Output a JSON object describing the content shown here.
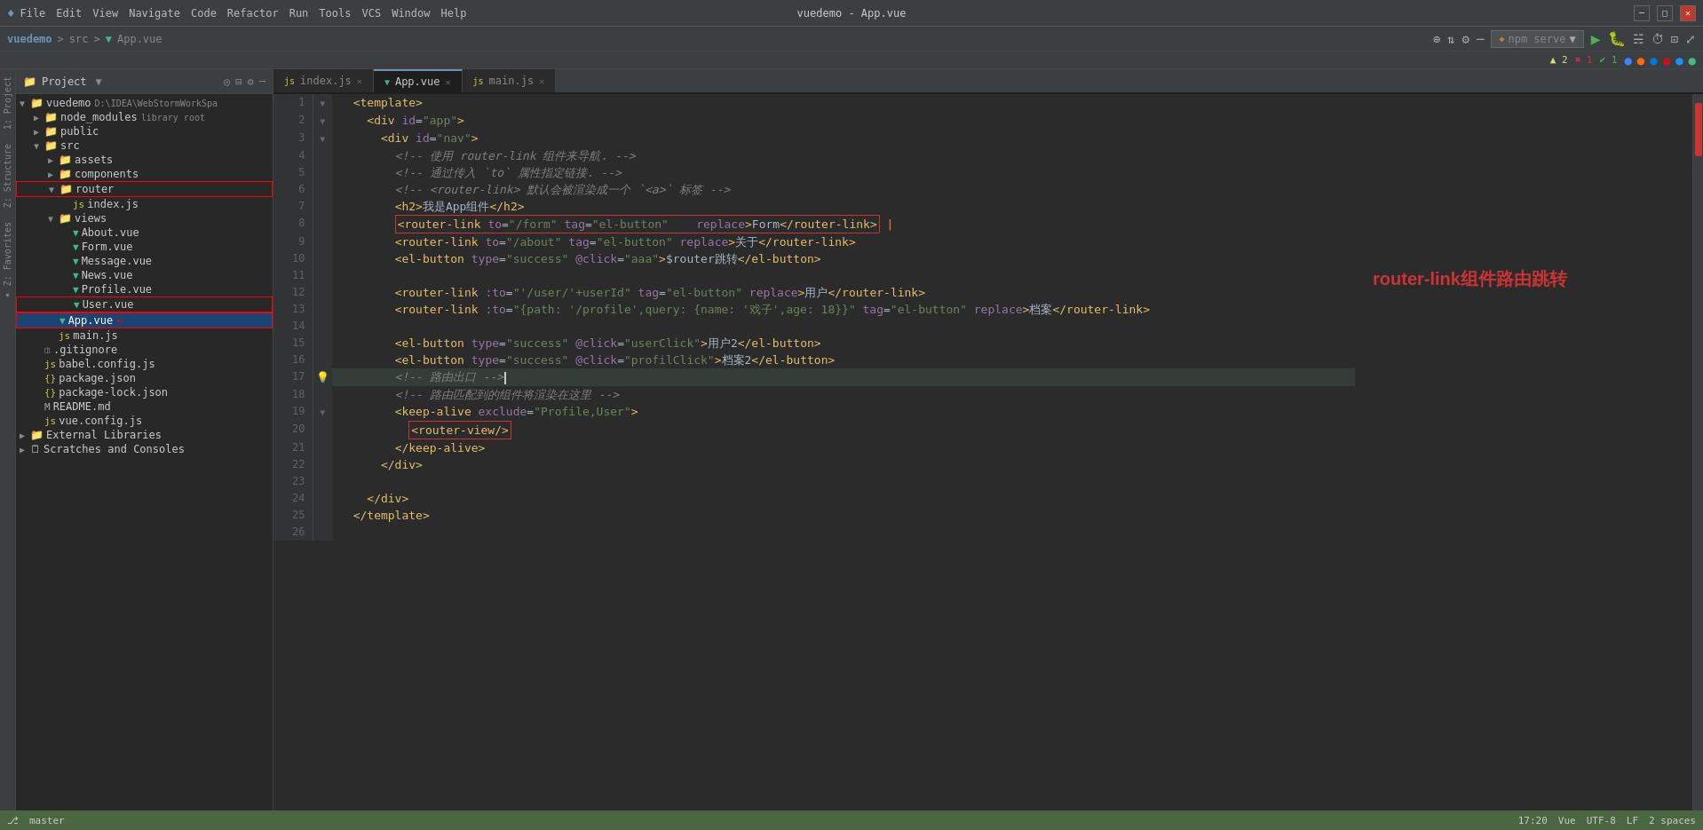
{
  "titleBar": {
    "appIcon": "♦",
    "menus": [
      "File",
      "Edit",
      "View",
      "Navigate",
      "Code",
      "Refactor",
      "Run",
      "Tools",
      "VCS",
      "Window",
      "Help"
    ],
    "title": "vuedemo - App.vue",
    "winMin": "─",
    "winMax": "□",
    "winClose": "✕"
  },
  "breadcrumb": {
    "project": "vuedemo",
    "sep1": ">",
    "src": "src",
    "sep2": ">",
    "file": "App.vue"
  },
  "tabs": [
    {
      "label": "index.js",
      "type": "js",
      "active": false,
      "closable": true
    },
    {
      "label": "App.vue",
      "type": "vue",
      "active": true,
      "closable": true
    },
    {
      "label": "main.js",
      "type": "js",
      "active": false,
      "closable": true
    }
  ],
  "fileTree": {
    "title": "Project",
    "items": [
      {
        "id": "vuedemo",
        "label": "vuedemo",
        "path": "D:\\IDEA\\WebStormWorkSpa",
        "indent": 0,
        "type": "folder",
        "expanded": true
      },
      {
        "id": "node_modules",
        "label": "node_modules",
        "badge": "library root",
        "indent": 1,
        "type": "folder",
        "expanded": false
      },
      {
        "id": "public",
        "label": "public",
        "indent": 1,
        "type": "folder",
        "expanded": false
      },
      {
        "id": "src",
        "label": "src",
        "indent": 1,
        "type": "folder",
        "expanded": true
      },
      {
        "id": "assets",
        "label": "assets",
        "indent": 2,
        "type": "folder",
        "expanded": false
      },
      {
        "id": "components",
        "label": "components",
        "indent": 2,
        "type": "folder",
        "expanded": false
      },
      {
        "id": "router",
        "label": "router",
        "indent": 2,
        "type": "folder",
        "expanded": true
      },
      {
        "id": "router_index",
        "label": "index.js",
        "indent": 3,
        "type": "js"
      },
      {
        "id": "views",
        "label": "views",
        "indent": 2,
        "type": "folder",
        "expanded": true
      },
      {
        "id": "about",
        "label": "About.vue",
        "indent": 3,
        "type": "vue"
      },
      {
        "id": "form",
        "label": "Form.vue",
        "indent": 3,
        "type": "vue"
      },
      {
        "id": "message",
        "label": "Message.vue",
        "indent": 3,
        "type": "vue"
      },
      {
        "id": "news",
        "label": "News.vue",
        "indent": 3,
        "type": "vue"
      },
      {
        "id": "profile",
        "label": "Profile.vue",
        "indent": 3,
        "type": "vue"
      },
      {
        "id": "user",
        "label": "User.vue",
        "indent": 3,
        "type": "vue",
        "redBorder": true
      },
      {
        "id": "appvue",
        "label": "App.vue",
        "indent": 2,
        "type": "vue",
        "selected": true,
        "redBorder": true
      },
      {
        "id": "mainjs",
        "label": "main.js",
        "indent": 2,
        "type": "js"
      },
      {
        "id": "gitignore",
        "label": ".gitignore",
        "indent": 1,
        "type": "git"
      },
      {
        "id": "babelconfig",
        "label": "babel.config.js",
        "indent": 1,
        "type": "js"
      },
      {
        "id": "packagejson",
        "label": "package.json",
        "indent": 1,
        "type": "json"
      },
      {
        "id": "packagelock",
        "label": "package-lock.json",
        "indent": 1,
        "type": "json"
      },
      {
        "id": "readme",
        "label": "README.md",
        "indent": 1,
        "type": "md"
      },
      {
        "id": "vueconfig",
        "label": "vue.config.js",
        "indent": 1,
        "type": "js"
      },
      {
        "id": "extlibs",
        "label": "External Libraries",
        "indent": 0,
        "type": "folder",
        "expanded": false
      },
      {
        "id": "scratches",
        "label": "Scratches and Consoles",
        "indent": 0,
        "type": "folder",
        "expanded": false
      }
    ]
  },
  "codeLines": [
    {
      "num": 1,
      "code": "  <template>",
      "type": "normal",
      "gutter": "fold"
    },
    {
      "num": 2,
      "code": "    <div id=\"app\">",
      "type": "normal",
      "gutter": "fold"
    },
    {
      "num": 3,
      "code": "      <div id=\"nav\">",
      "type": "normal",
      "gutter": "fold"
    },
    {
      "num": 4,
      "code": "        <!-- 使用 router-link 组件来导航. -->",
      "type": "comment"
    },
    {
      "num": 5,
      "code": "        <!-- 通过传入 `to` 属性指定链接. -->",
      "type": "comment"
    },
    {
      "num": 6,
      "code": "        <!-- <router-link> 默认会被渲染成一个 `<a>` 标签 -->",
      "type": "comment"
    },
    {
      "num": 7,
      "code": "        <h2>我是App组件</h2>",
      "type": "normal"
    },
    {
      "num": 8,
      "code": "        <router-link to=\"/form\" tag=\"el-button\"    replace>Form</router-link> |",
      "type": "normal",
      "redBox": true
    },
    {
      "num": 9,
      "code": "        <router-link to=\"/about\" tag=\"el-button\" replace>关于</router-link>",
      "type": "normal"
    },
    {
      "num": 10,
      "code": "        <el-button type=\"success\" @click=\"aaa\">$router跳转</el-button>",
      "type": "normal"
    },
    {
      "num": 11,
      "code": "",
      "type": "normal"
    },
    {
      "num": 12,
      "code": "        <router-link :to=\"'/user/'+userId\" tag=\"el-button\" replace>用户</router-link>",
      "type": "normal"
    },
    {
      "num": 13,
      "code": "        <router-link :to=\"{path: '/profile',query: {name: '戏子',age: 18}}\" tag=\"el-button\" replace>档案</router-link>",
      "type": "normal"
    },
    {
      "num": 14,
      "code": "",
      "type": "normal"
    },
    {
      "num": 15,
      "code": "        <el-button type=\"success\" @click=\"userClick\">用户2</el-button>",
      "type": "normal"
    },
    {
      "num": 16,
      "code": "        <el-button type=\"success\" @click=\"profilClick\">档案2</el-button>",
      "type": "normal"
    },
    {
      "num": 17,
      "code": "        <!-- 路由出口 -->",
      "type": "comment",
      "highlighted": true,
      "gutter": "bulb"
    },
    {
      "num": 18,
      "code": "        <!-- 路由匹配到的组件将渲染在这里 -->",
      "type": "comment"
    },
    {
      "num": 19,
      "code": "        <keep-alive exclude=\"Profile,User\">",
      "type": "normal",
      "gutter": "fold"
    },
    {
      "num": 20,
      "code": "          <router-view/>",
      "type": "normal",
      "redBox": true
    },
    {
      "num": 21,
      "code": "        </keep-alive>",
      "type": "normal"
    },
    {
      "num": 22,
      "code": "      </div>",
      "type": "normal"
    },
    {
      "num": 23,
      "code": "",
      "type": "normal"
    },
    {
      "num": 24,
      "code": "    </div>",
      "type": "normal"
    },
    {
      "num": 25,
      "code": "  </template>",
      "type": "normal"
    },
    {
      "num": 26,
      "code": "",
      "type": "normal"
    }
  ],
  "annotationText": "router-link组件路由跳转",
  "warnings": {
    "warn": "▲ 2",
    "err1": "✖ 1",
    "info": "✔ 1"
  },
  "npmServe": "npm serve",
  "statusBar": {
    "encoding": "UTF-8",
    "lineEnding": "LF",
    "indent": "2 spaces",
    "fileType": "Vue",
    "position": "17:20",
    "branch": "master"
  },
  "browserIcons": [
    "●",
    "●",
    "●",
    "●",
    "●",
    "●"
  ]
}
